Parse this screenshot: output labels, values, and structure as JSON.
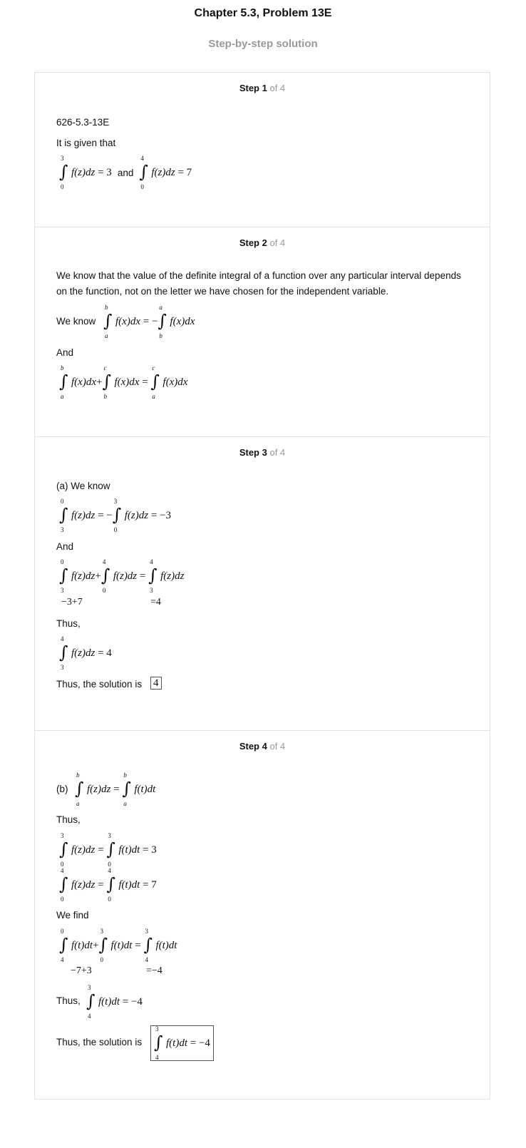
{
  "header": {
    "title": "Chapter 5.3, Problem 13E",
    "subtitle": "Step-by-step solution"
  },
  "steps": [
    {
      "num": "Step 1",
      "of": "of 4"
    },
    {
      "num": "Step 2",
      "of": "of 4"
    },
    {
      "num": "Step 3",
      "of": "of 4"
    },
    {
      "num": "Step 4",
      "of": "of 4"
    }
  ],
  "step1": {
    "code": "626-5.3-13E",
    "given": "It is given that",
    "and": "and"
  },
  "step2": {
    "paragraph": "We know that the value of the definite integral of a function over any particular interval depends on the function, not on the letter we have chosen for the independent variable.",
    "we_know": "We know",
    "and": "And"
  },
  "step3": {
    "a_we_know": "(a) We know",
    "and": "And",
    "sum_left": "−3+7",
    "sum_right": "=4",
    "thus1": "Thus,",
    "thus2": "Thus, the solution is",
    "answer": "4"
  },
  "step4": {
    "b": "(b)",
    "thus1": "Thus,",
    "we_find": "We find",
    "sum_left": "−7+3",
    "sum_right": "=−4",
    "thus2": "Thus,",
    "thus3": "Thus, the solution is"
  }
}
